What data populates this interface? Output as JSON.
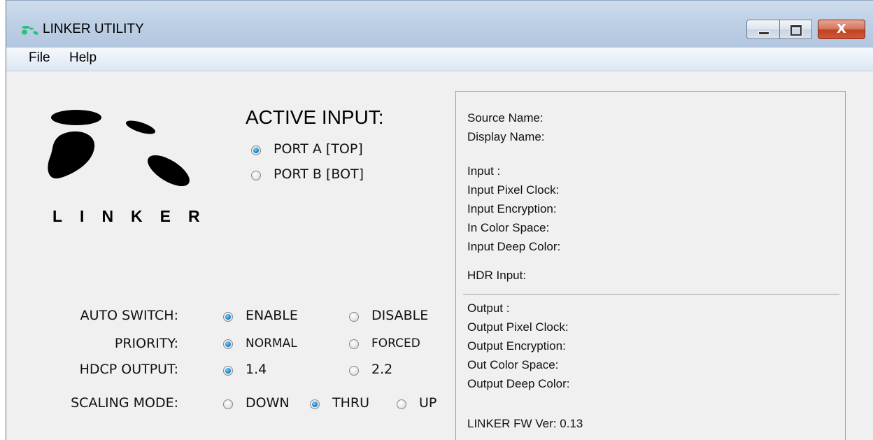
{
  "window": {
    "title": "LINKER UTILITY"
  },
  "controls": {
    "close_glyph": "X"
  },
  "menu": {
    "file": "File",
    "help": "Help"
  },
  "logo": {
    "wordmark": "LINKER"
  },
  "active_input": {
    "title": "ACTIVE INPUT:",
    "options": [
      {
        "label": "PORT A [TOP]",
        "checked": true
      },
      {
        "label": "PORT B [BOT]",
        "checked": false
      }
    ]
  },
  "settings": {
    "auto_switch": {
      "label": "AUTO SWITCH:",
      "options": [
        {
          "label": "ENABLE",
          "checked": true
        },
        {
          "label": "DISABLE",
          "checked": false
        }
      ]
    },
    "priority": {
      "label": "PRIORITY:",
      "options": [
        {
          "label": "NORMAL",
          "checked": true
        },
        {
          "label": "FORCED",
          "checked": false
        }
      ]
    },
    "hdcp_output": {
      "label": "HDCP OUTPUT:",
      "options": [
        {
          "label": "1.4",
          "checked": true
        },
        {
          "label": "2.2",
          "checked": false
        }
      ]
    },
    "scaling_mode": {
      "label": "SCALING MODE:",
      "options": [
        {
          "label": "DOWN",
          "checked": false
        },
        {
          "label": "THRU",
          "checked": true
        },
        {
          "label": "UP",
          "checked": false
        }
      ]
    }
  },
  "info": {
    "source_name": "Source Name:",
    "display_name": "Display Name:",
    "input": "Input :",
    "input_pixel_clock": "Input Pixel Clock:",
    "input_encryption": "Input Encryption:",
    "in_color_space": "In Color Space:",
    "input_deep_color": "Input Deep Color:",
    "hdr_input": "HDR Input:",
    "output": "Output :",
    "output_pixel_clock": "Output Pixel Clock:",
    "output_encryption": "Output Encryption:",
    "out_color_space": "Out Color Space:",
    "output_deep_color": "Output Deep Color:",
    "fw_version": "LINKER FW Ver: 0.13"
  }
}
